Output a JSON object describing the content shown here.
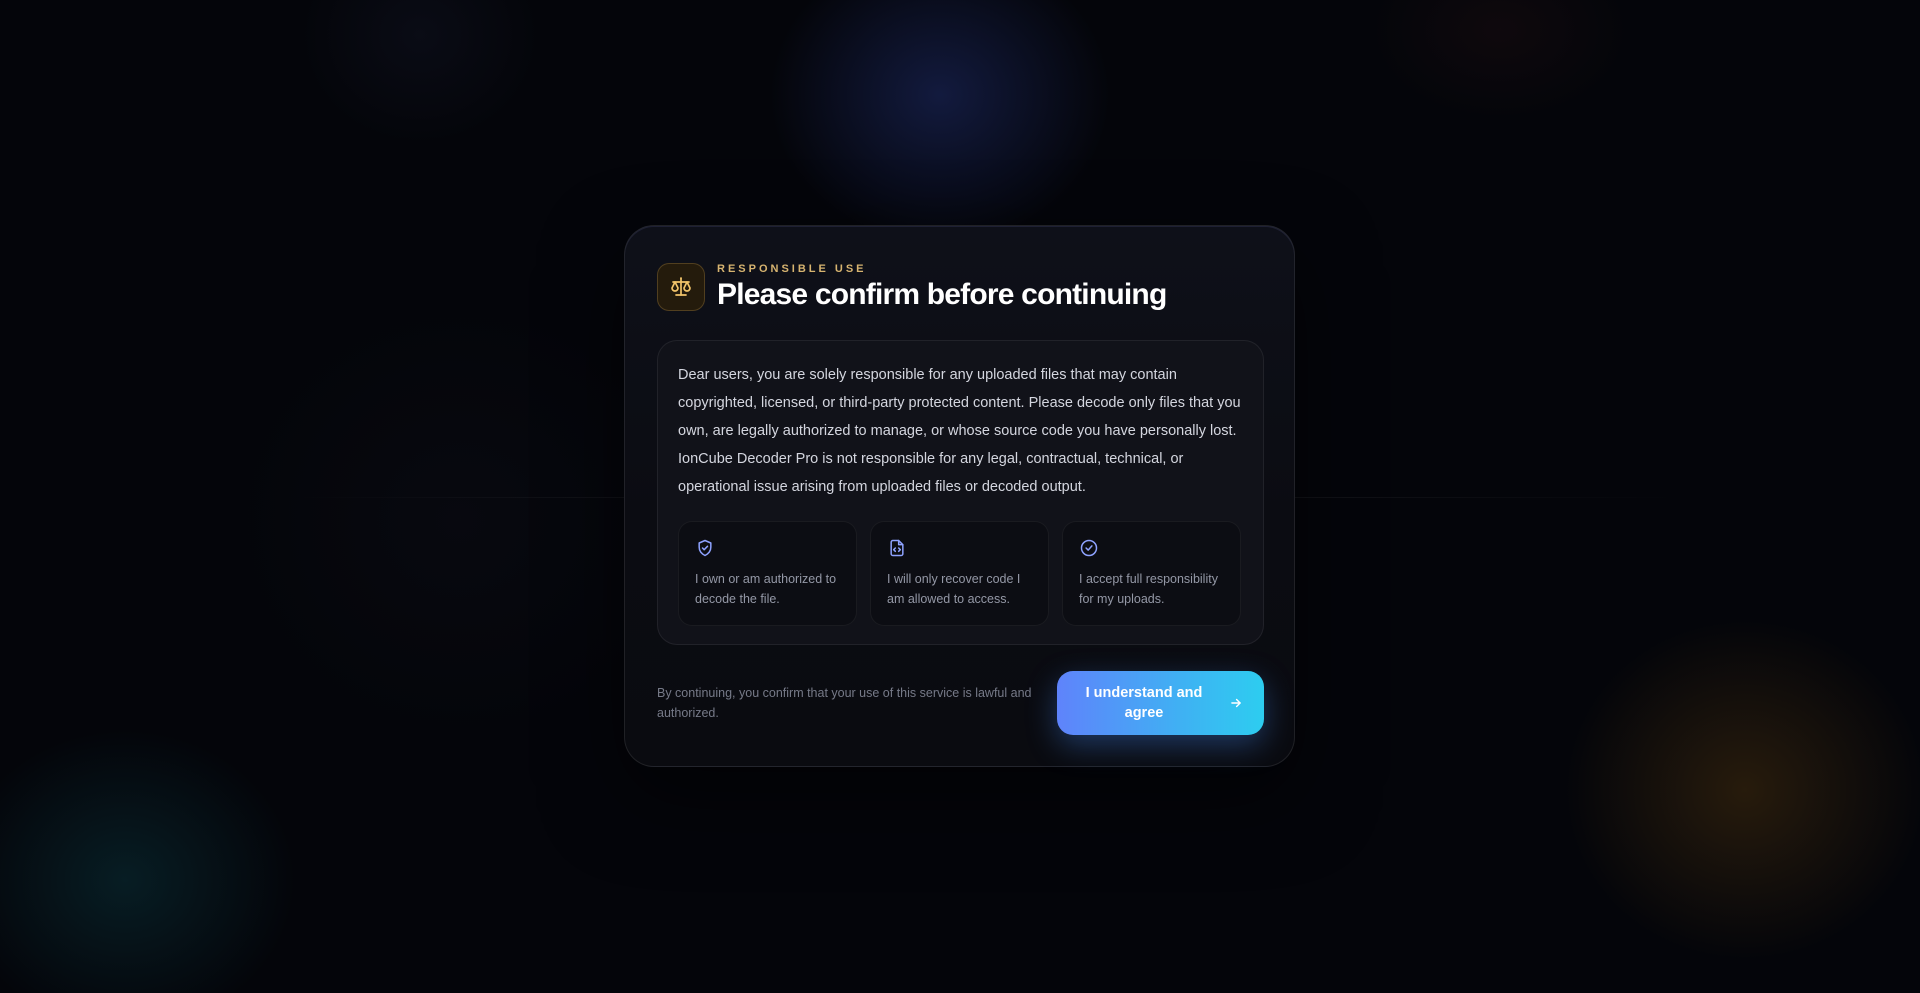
{
  "dialog": {
    "eyebrow": "RESPONSIBLE USE",
    "title": "Please confirm before continuing",
    "icon": "scale-icon",
    "notice": "Dear users, you are solely responsible for any uploaded files that may contain copyrighted, licensed, or third-party protected content. Please decode only files that you own, are legally authorized to manage, or whose source code you have personally lost. IonCube Decoder Pro is not responsible for any legal, contractual, technical, or operational issue arising from uploaded files or decoded output.",
    "checks": [
      {
        "icon": "shield-check-icon",
        "text": "I own or am authorized to decode the file."
      },
      {
        "icon": "file-code-icon",
        "text": "I will only recover code I am allowed to access."
      },
      {
        "icon": "check-circle-icon",
        "text": "I accept full responsibility for my uploads."
      }
    ],
    "footer": "By continuing, you confirm that your use of this service is lawful and authorized.",
    "button_label": "I understand and agree",
    "button_icon": "arrow-right-icon"
  },
  "colors": {
    "accent_gold": "#d7b470",
    "icon_blue": "#8ea2ff",
    "button_start": "#5f83fb",
    "button_end": "#2dcdf0",
    "background": "#04050a"
  }
}
